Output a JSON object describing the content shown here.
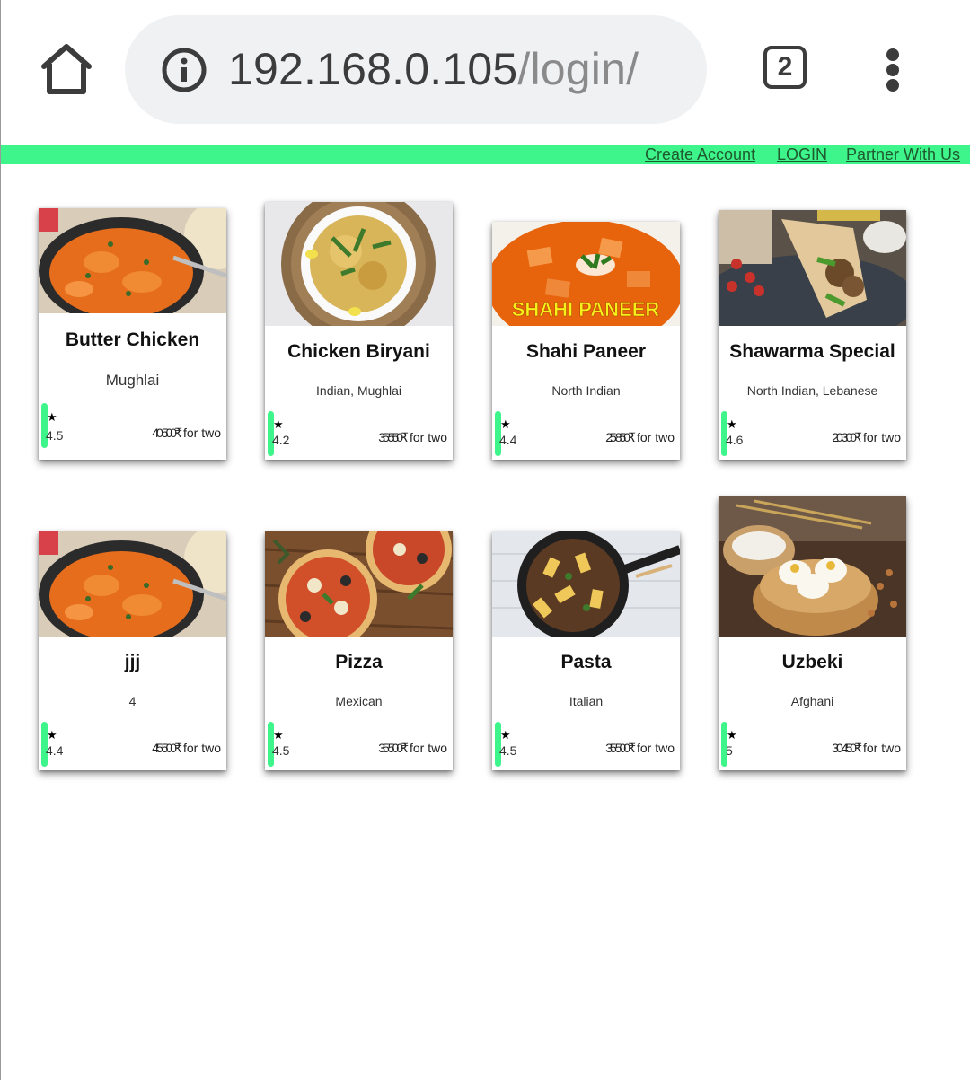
{
  "browser": {
    "url_host": "192.168.0.105",
    "url_path": "/login/",
    "tab_count": "2"
  },
  "nav": {
    "create_account": "Create Account",
    "login": "LOGIN",
    "partner": "Partner With Us"
  },
  "colors": {
    "accent_green": "#3df58a",
    "chrome_gray": "#f0f1f3"
  },
  "cards": [
    {
      "name": "Butter Chicken",
      "cuisine": "Mughlai",
      "star": "★",
      "rating": "4.5",
      "price": "40 500₹",
      "price_suffix": "for two",
      "image": "butter-chicken"
    },
    {
      "name": "Chicken Biryani",
      "cuisine": "Indian, Mughlai",
      "star": "★",
      "rating": "4.2",
      "price": "35 550₹",
      "price_suffix": "for two",
      "image": "chicken-biryani"
    },
    {
      "name": "Shahi Paneer",
      "cuisine": "North Indian",
      "star": "★",
      "rating": "4.4",
      "price": "25 850₹",
      "price_suffix": "for two",
      "image": "shahi-paneer",
      "image_caption": "SHAHI PANEER"
    },
    {
      "name": "Shawarma Special",
      "cuisine": "North Indian, Lebanese",
      "star": "★",
      "rating": "4.6",
      "price": "20 300₹",
      "price_suffix": "for two",
      "image": "shawarma"
    },
    {
      "name": "jjj",
      "cuisine": "4",
      "star": "★",
      "rating": "4.4",
      "price": "45 500₹",
      "price_suffix": "for two",
      "image": "butter-chicken"
    },
    {
      "name": "Pizza",
      "cuisine": "Mexican",
      "star": "★",
      "rating": "4.5",
      "price": "35 500₹",
      "price_suffix": "for two",
      "image": "pizza"
    },
    {
      "name": "Pasta",
      "cuisine": "Italian",
      "star": "★",
      "rating": "4.5",
      "price": "35 500₹",
      "price_suffix": "for two",
      "image": "pasta"
    },
    {
      "name": "Uzbeki",
      "cuisine": "Afghani",
      "star": "★",
      "rating": "5",
      "price": "30 450₹",
      "price_suffix": "for two",
      "image": "uzbeki"
    }
  ]
}
